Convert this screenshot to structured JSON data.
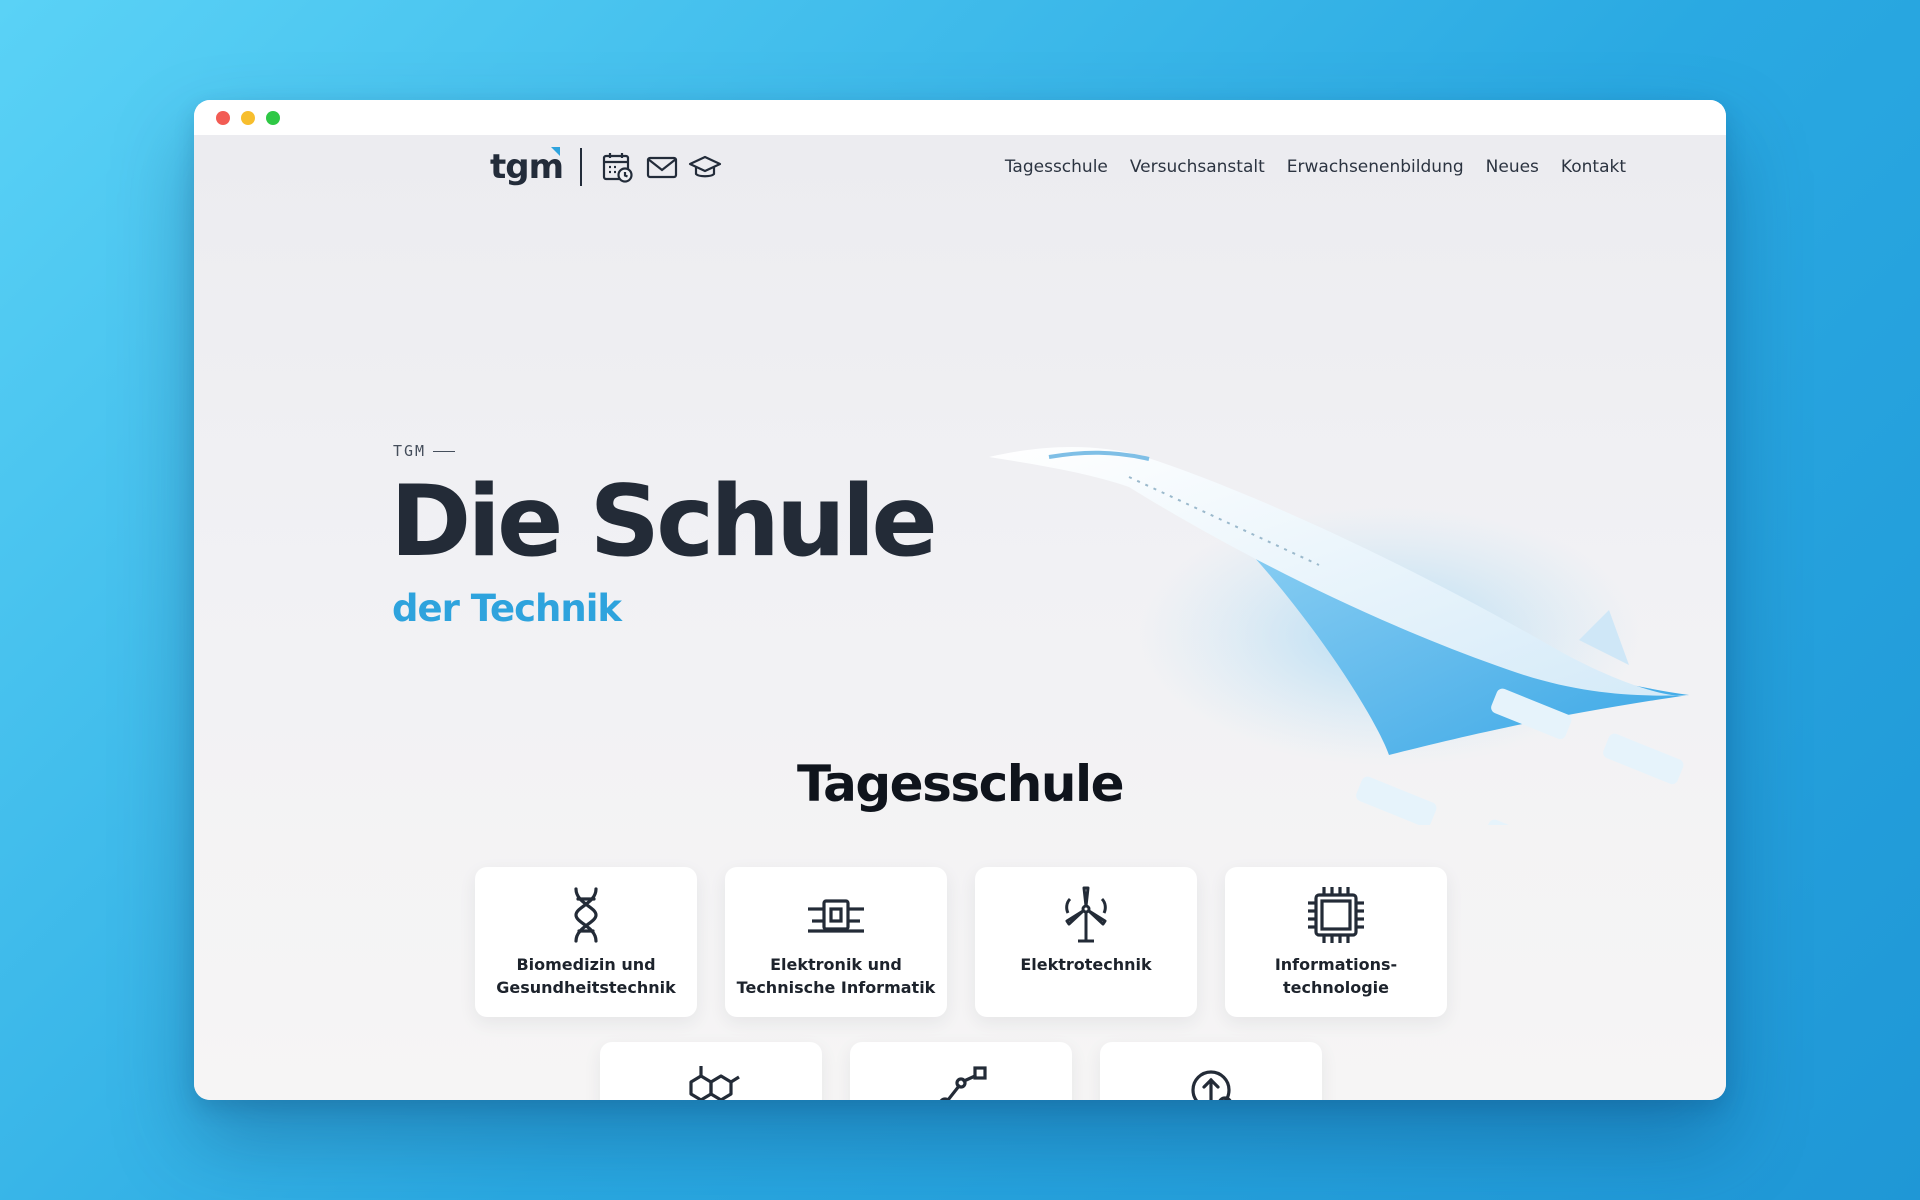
{
  "header": {
    "logo": "tgm",
    "icons": [
      "calendar-icon",
      "mail-icon",
      "graduation-cap-icon"
    ],
    "nav": [
      "Tagesschule",
      "Versuchsanstalt",
      "Erwachsenenbildung",
      "Neues",
      "Kontakt"
    ]
  },
  "hero": {
    "eyebrow": "TGM",
    "title": "Die Schule",
    "subtitle": "der Technik",
    "image": "supersonic-jet-illustration"
  },
  "section": {
    "title": "Tagesschule",
    "cards": [
      {
        "label": "Biomedizin und\nGesundheitstechnik",
        "icon": "dna-icon"
      },
      {
        "label": "Elektronik und\nTechnische Informatik",
        "icon": "circuit-board-icon"
      },
      {
        "label": "Elektrotechnik",
        "icon": "wind-turbine-icon"
      },
      {
        "label": "Informations-\ntechnologie",
        "icon": "microchip-icon"
      },
      {
        "label": "",
        "icon": "molecule-icon"
      },
      {
        "label": "",
        "icon": "robot-arm-icon"
      },
      {
        "label": "",
        "icon": "gear-arrow-icon"
      }
    ]
  },
  "colors": {
    "accent": "#2ea3dd",
    "text": "#232b37",
    "background": "#f0f0f3"
  }
}
